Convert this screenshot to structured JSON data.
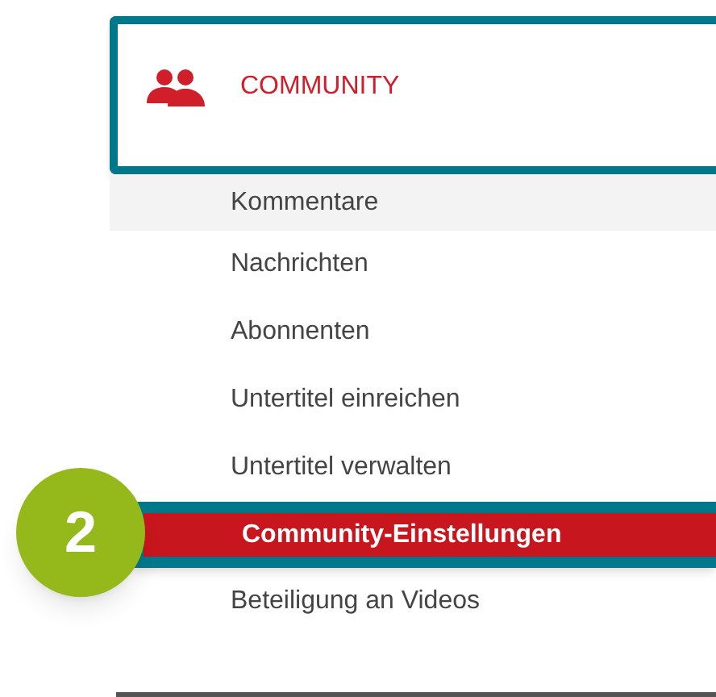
{
  "section": {
    "title": "COMMUNITY"
  },
  "items": [
    {
      "label": "Kommentare",
      "selected": false,
      "hovered": true
    },
    {
      "label": "Nachrichten",
      "selected": false,
      "hovered": false
    },
    {
      "label": "Abonnenten",
      "selected": false,
      "hovered": false
    },
    {
      "label": "Untertitel einreichen",
      "selected": false,
      "hovered": false
    },
    {
      "label": "Untertitel verwalten",
      "selected": false,
      "hovered": false
    },
    {
      "label": "Community-Einstellungen",
      "selected": true,
      "hovered": false
    },
    {
      "label": "Beteiligung an Videos",
      "selected": false,
      "hovered": false
    }
  ],
  "step_badge": "2"
}
